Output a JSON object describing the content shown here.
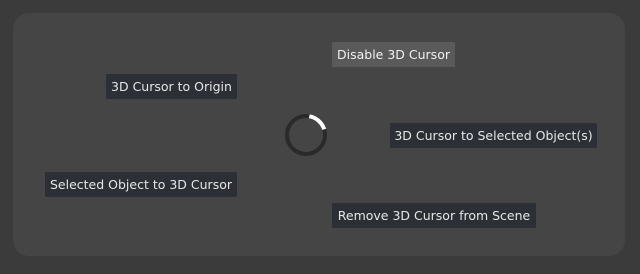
{
  "pie_menu": {
    "items": {
      "disable_cursor": "Disable 3D Cursor",
      "cursor_to_origin": "3D Cursor to Origin",
      "cursor_to_selected": "3D Cursor to Selected Object(s)",
      "selected_to_cursor": "Selected Object to 3D Cursor",
      "remove_cursor": "Remove 3D Cursor from Scene"
    },
    "colors": {
      "panel": "#454545",
      "button": "#2c2f35",
      "button_active": "#5a5a5a",
      "text": "#e6e6e6",
      "ring": "#2a2a2a",
      "ring_indicator": "#ffffff"
    }
  }
}
